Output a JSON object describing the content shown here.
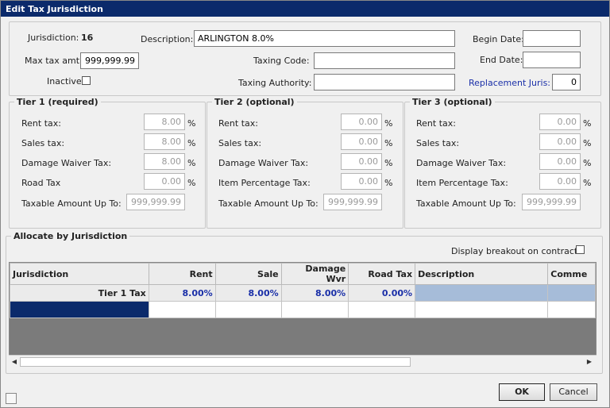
{
  "window": {
    "title": "Edit Tax Jurisdiction"
  },
  "header": {
    "jurisdiction_label": "Jurisdiction:",
    "jurisdiction_value": "16",
    "description_label": "Description:",
    "description_value": "ARLINGTON 8.0%",
    "begin_date_label": "Begin Date:",
    "begin_date_value": "",
    "max_tax_label": "Max tax amt:",
    "max_tax_value": "999,999.99",
    "taxing_code_label": "Taxing Code:",
    "taxing_code_value": "",
    "end_date_label": "End Date:",
    "end_date_value": "",
    "inactive_label": "Inactive",
    "inactive_checked": false,
    "taxing_authority_label": "Taxing Authority:",
    "taxing_authority_value": "",
    "replacement_label": "Replacement Juris:",
    "replacement_value": "0"
  },
  "tiers": [
    {
      "legend": "Tier 1 (required)",
      "rows": [
        {
          "label": "Rent tax:",
          "value": "8.00",
          "unit": "%"
        },
        {
          "label": "Sales tax:",
          "value": "8.00",
          "unit": "%"
        },
        {
          "label": "Damage Waiver Tax:",
          "value": "8.00",
          "unit": "%"
        },
        {
          "label": "Road Tax",
          "value": "0.00",
          "unit": "%"
        }
      ],
      "taxable_label": "Taxable Amount Up To:",
      "taxable_value": "999,999.99"
    },
    {
      "legend": "Tier 2 (optional)",
      "rows": [
        {
          "label": "Rent tax:",
          "value": "0.00",
          "unit": "%"
        },
        {
          "label": "Sales tax:",
          "value": "0.00",
          "unit": "%"
        },
        {
          "label": "Damage Waiver Tax:",
          "value": "0.00",
          "unit": "%"
        },
        {
          "label": "Item Percentage Tax:",
          "value": "0.00",
          "unit": "%"
        }
      ],
      "taxable_label": "Taxable Amount Up To:",
      "taxable_value": "999,999.99"
    },
    {
      "legend": "Tier 3 (optional)",
      "rows": [
        {
          "label": "Rent tax:",
          "value": "0.00",
          "unit": "%"
        },
        {
          "label": "Sales tax:",
          "value": "0.00",
          "unit": "%"
        },
        {
          "label": "Damage Waiver Tax:",
          "value": "0.00",
          "unit": "%"
        },
        {
          "label": "Item Percentage Tax:",
          "value": "0.00",
          "unit": "%"
        }
      ],
      "taxable_label": "Taxable Amount Up To:",
      "taxable_value": "999,999.99"
    }
  ],
  "allocate": {
    "legend": "Allocate by Jurisdiction",
    "breakout_label": "Display breakout on contract",
    "breakout_checked": false,
    "columns": [
      "Jurisdiction",
      "Rent",
      "Sale",
      "Damage Wvr",
      "Road Tax",
      "Description",
      "Comme"
    ],
    "rows": [
      [
        "Tier 1 Tax",
        "8.00%",
        "8.00%",
        "8.00%",
        "0.00%",
        "",
        ""
      ]
    ]
  },
  "buttons": {
    "ok": "OK",
    "cancel": "Cancel"
  },
  "colors": {
    "titlebar": "#0b2a6b",
    "link": "#1a2fa8",
    "selection": "#0b2a6b",
    "desc_highlight": "#a6bcd9",
    "tier_value": "#1a2fa8"
  }
}
